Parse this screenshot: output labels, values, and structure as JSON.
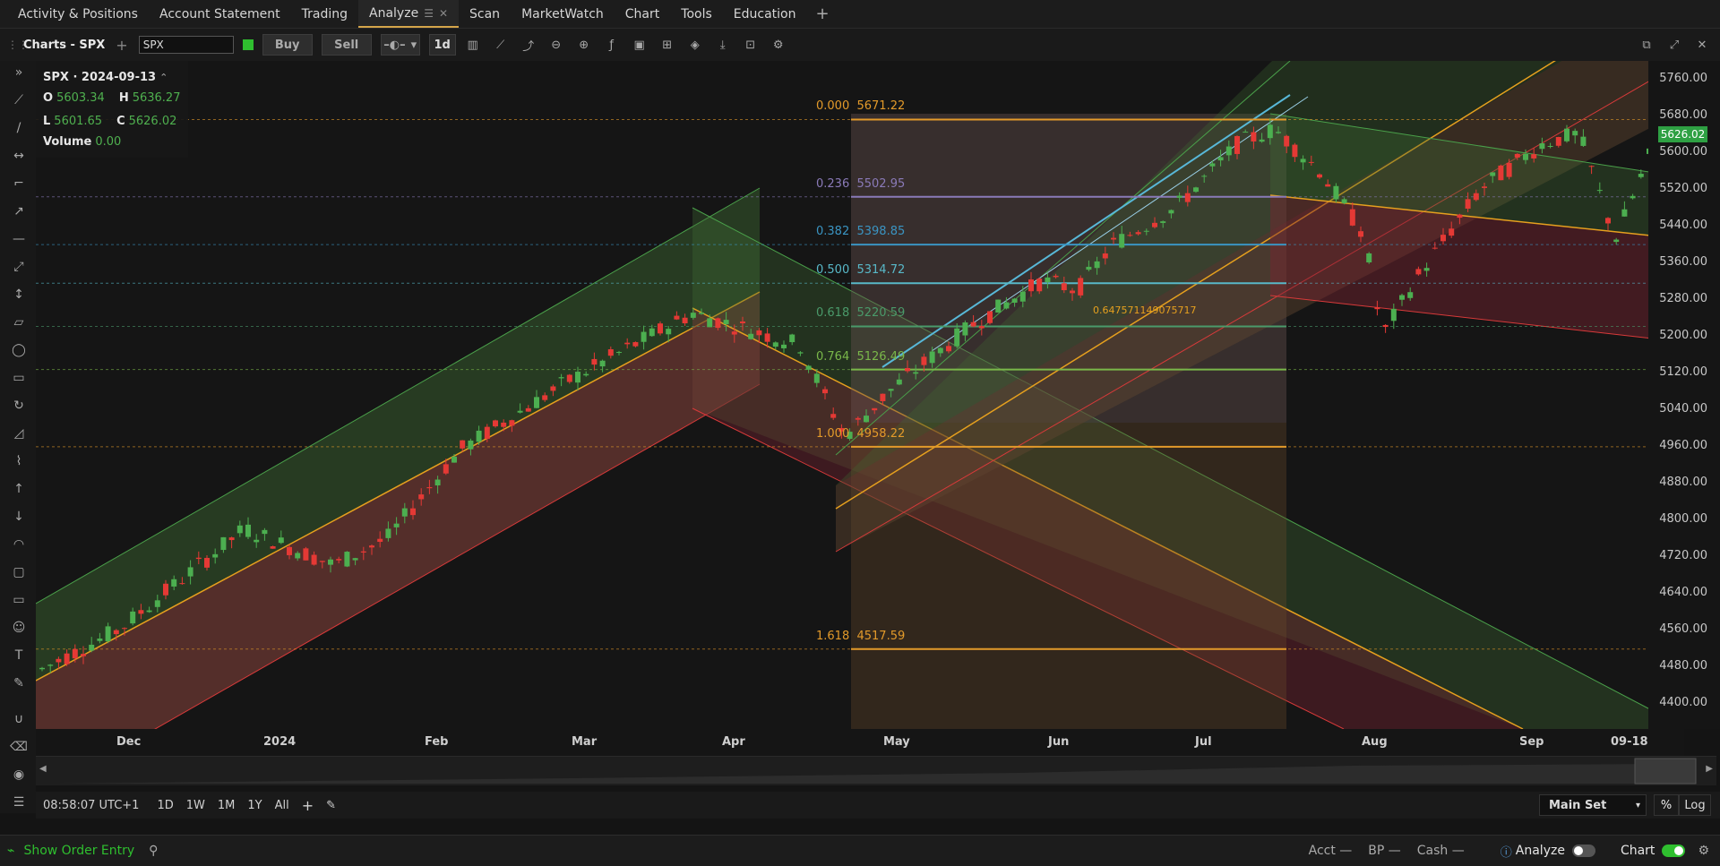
{
  "nav": {
    "tabs": [
      "Activity & Positions",
      "Account Statement",
      "Trading",
      "Analyze",
      "Scan",
      "MarketWatch",
      "Chart",
      "Tools",
      "Education"
    ],
    "add": "+"
  },
  "toolbar": {
    "title": "Charts - SPX",
    "symbol": "SPX",
    "buy": "Buy",
    "sell": "Sell",
    "interval": "1d"
  },
  "ohlc": {
    "header": "SPX · 2024-09-13",
    "o_label": "O",
    "o": "5603.34",
    "h_label": "H",
    "h": "5636.27",
    "l_label": "L",
    "l": "5601.65",
    "c_label": "C",
    "c": "5626.02",
    "vol_label": "Volume",
    "vol": "0.00"
  },
  "yaxis": [
    "5760.00",
    "5680.00",
    "5600.00",
    "5520.00",
    "5440.00",
    "5360.00",
    "5280.00",
    "5200.00",
    "5120.00",
    "5040.00",
    "4960.00",
    "4880.00",
    "4800.00",
    "4720.00",
    "4640.00",
    "4560.00",
    "4480.00",
    "4400.00"
  ],
  "last_price": "5626.02",
  "xaxis": [
    "Dec",
    "2024",
    "Feb",
    "Mar",
    "Apr",
    "May",
    "Jun",
    "Jul",
    "Aug",
    "Sep",
    "09-18"
  ],
  "fib": [
    {
      "ratio": "0.000",
      "price": "5671.22",
      "color": "#e39a2a"
    },
    {
      "ratio": "0.236",
      "price": "5502.95",
      "color": "#8a7ab8"
    },
    {
      "ratio": "0.382",
      "price": "5398.85",
      "color": "#3a94c2"
    },
    {
      "ratio": "0.500",
      "price": "5314.72",
      "color": "#58b8c8"
    },
    {
      "ratio": "0.618",
      "price": "5220.59",
      "color": "#4a9a6a"
    },
    {
      "ratio": "0.764",
      "price": "5126.49",
      "color": "#7ab84a"
    },
    {
      "ratio": "1.000",
      "price": "4958.22",
      "color": "#e39a2a"
    },
    {
      "ratio": "1.618",
      "price": "4517.59",
      "color": "#e39a2a"
    }
  ],
  "fib_note": "0.647571149075717",
  "bottom": {
    "time": "08:58:07 UTC+1",
    "ranges": [
      "1D",
      "1W",
      "1M",
      "1Y",
      "All"
    ],
    "plus": "+",
    "set": "Main Set",
    "pct": "%",
    "log": "Log"
  },
  "status": {
    "order": "Show Order Entry",
    "acct": "Acct —",
    "bp": "BP —",
    "cash": "Cash —",
    "analyze": "Analyze",
    "chart": "Chart"
  }
}
